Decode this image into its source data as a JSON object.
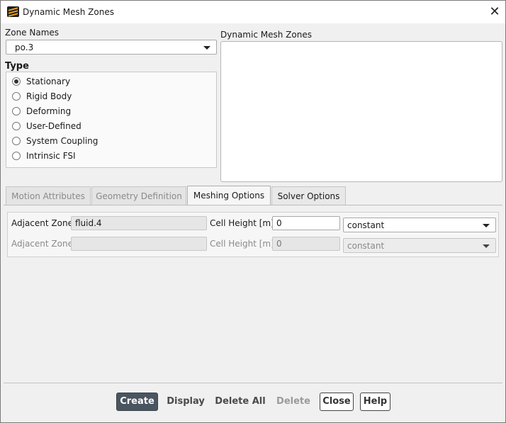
{
  "window": {
    "title": "Dynamic Mesh Zones",
    "close_glyph": "✕"
  },
  "zone_names": {
    "label": "Zone Names",
    "selected": "po.3"
  },
  "type": {
    "label": "Type",
    "options": [
      "Stationary",
      "Rigid Body",
      "Deforming",
      "User-Defined",
      "System Coupling",
      "Intrinsic FSI"
    ],
    "selected": "Stationary"
  },
  "dynamic_mesh_zones": {
    "label": "Dynamic Mesh Zones",
    "items": []
  },
  "tabs": [
    {
      "label": "Motion Attributes",
      "state": "disabled"
    },
    {
      "label": "Geometry Definition",
      "state": "disabled"
    },
    {
      "label": "Meshing Options",
      "state": "active"
    },
    {
      "label": "Solver Options",
      "state": "normal"
    }
  ],
  "meshing": {
    "rows": [
      {
        "adjacent_label": "Adjacent Zone",
        "adjacent_value": "fluid.4",
        "height_label": "Cell Height [m]",
        "height_value": "0",
        "method": "constant",
        "enabled": true
      },
      {
        "adjacent_label": "Adjacent Zone",
        "adjacent_value": "",
        "height_label": "Cell Height [m]",
        "height_value": "0",
        "method": "constant",
        "enabled": false
      }
    ]
  },
  "buttons": {
    "create": "Create",
    "display": "Display",
    "delete_all": "Delete All",
    "delete": "Delete",
    "close": "Close",
    "help": "Help"
  },
  "colors": {
    "accent": "#4a5560",
    "icon_orange": "#e8a020"
  }
}
